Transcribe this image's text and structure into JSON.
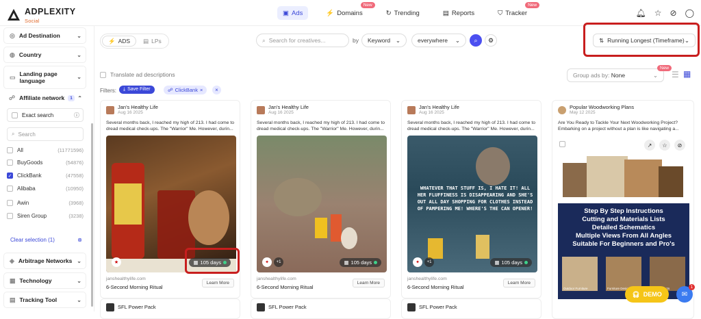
{
  "brand": {
    "name": "ADPLEXITY",
    "sub": "Social"
  },
  "nav": [
    {
      "label": "Ads",
      "icon": "ads-icon",
      "active": true
    },
    {
      "label": "Domains",
      "icon": "domains-icon",
      "badge": "New"
    },
    {
      "label": "Trending",
      "icon": "trending-icon"
    },
    {
      "label": "Reports",
      "icon": "reports-icon"
    },
    {
      "label": "Tracker",
      "icon": "tracker-icon",
      "badge": "New"
    }
  ],
  "sidebar": {
    "sections": [
      "Ad Destination",
      "Country",
      "Landing page language",
      "Affiliate network",
      "Arbitrage Networks",
      "Technology",
      "Tracking Tool"
    ],
    "affiliate_badge": "1",
    "exact_search": "Exact search",
    "search_placeholder": "Search",
    "networks": [
      {
        "name": "All",
        "count": "(11771596)"
      },
      {
        "name": "BuyGoods",
        "count": "(54876)"
      },
      {
        "name": "ClickBank",
        "count": "(47558)",
        "checked": true
      },
      {
        "name": "Alibaba",
        "count": "(10950)"
      },
      {
        "name": "Awin",
        "count": "(3968)"
      },
      {
        "name": "Siren Group",
        "count": "(3238)"
      }
    ],
    "clear": "Clear selection (1)"
  },
  "toolbar": {
    "ads_tab": "ADS",
    "lps_tab": "LPs",
    "search_placeholder": "Search for creatives...",
    "by": "by",
    "keyword": "Keyword",
    "where": "everywhere",
    "sort": "Running Longest (Timeframe)"
  },
  "options": {
    "translate": "Translate ad descriptions",
    "group_label": "Group ads by:",
    "group_value": "None",
    "group_badge": "New"
  },
  "filters": {
    "label": "Filters:",
    "save": "Save Filter",
    "chip": "ClickBank"
  },
  "cards": [
    {
      "name": "Jan's Healthy Life",
      "date": "Aug 16 2025",
      "text": "Several months back, I reached my high of 213. I had come to dread medical check-ups. The \"Warrior\" Me. However, durin...",
      "days": "105 days",
      "url": "janshealthylife.com",
      "title": "6-Second Morning Ritual",
      "learn": "Learn More",
      "plus": ""
    },
    {
      "name": "Jan's Healthy Life",
      "date": "Aug 16 2025",
      "text": "Several months back, I reached my high of 213. I had come to dread medical check-ups. The \"Warrior\" Me. However, durin...",
      "days": "105 days",
      "url": "janshealthylife.com",
      "title": "6-Second Morning Ritual",
      "learn": "Learn More",
      "plus": "+1"
    },
    {
      "name": "Jan's Healthy Life",
      "date": "Aug 16 2025",
      "text": "Several months back, I reached my high of 213. I had come to dread medical check-ups. The \"Warrior\" Me. However, durin...",
      "days": "105 days",
      "url": "janshealthylife.com",
      "title": "6-Second Morning Ritual",
      "learn": "Learn More",
      "plus": "+1",
      "overlay": "WHATEVER THAT STUFF IS, I HATE IT! ALL HER FLUFFINESS IS DISAPPEARING AND SHE'S OUT ALL DAY SHOPPING FOR CLOTHES INSTEAD OF PAMPERING ME! WHERE'S THE CAN OPENER!"
    },
    {
      "name": "Popular Woodworking Plans",
      "date": "May 12 2025",
      "text": "Are You Ready to Tackle Your Next Woodworking Project? Embarking on a project without a plan is like navigating a...",
      "lines": [
        "Step By Step Instructions",
        "Cutting and Materials Lists",
        "Detailed Schematics",
        "Multiple Views From All Angles",
        "Suitable For Beginners and Pro's"
      ],
      "captions": [
        "Outdoor Furniture",
        "Furniture Design",
        "Craft Projects"
      ]
    }
  ],
  "next_cards": [
    "SFL Power Pack",
    "SFL Power Pack",
    "SFL Power Pack"
  ],
  "demo": "DEMO",
  "chat_badge": "1"
}
